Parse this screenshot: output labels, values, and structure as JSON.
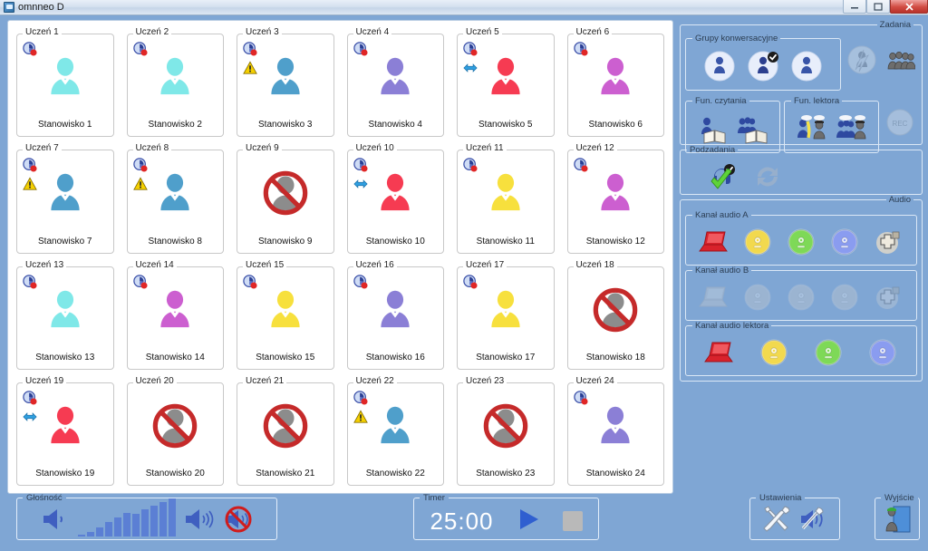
{
  "window": {
    "title": "omnneo D",
    "icon": "app-icon",
    "controls": [
      {
        "name": "minimize",
        "glyph": "—"
      },
      {
        "name": "maximize",
        "glyph": "❐"
      },
      {
        "name": "close",
        "glyph": "✕"
      }
    ]
  },
  "students": [
    {
      "student": "Uczeń 1",
      "station": "Stanowisko 1",
      "color": "#7fe8e8",
      "state": "online",
      "badges": [
        "clock-badge"
      ]
    },
    {
      "student": "Uczeń 2",
      "station": "Stanowisko 2",
      "color": "#7fe8e8",
      "state": "online",
      "badges": [
        "clock-badge"
      ]
    },
    {
      "student": "Uczeń 3",
      "station": "Stanowisko 3",
      "color": "#4f9fcb",
      "state": "online",
      "badges": [
        "clock-badge",
        "warning-badge"
      ]
    },
    {
      "student": "Uczeń 4",
      "station": "Stanowisko 4",
      "color": "#8b7fd6",
      "state": "online",
      "badges": [
        "clock-badge"
      ]
    },
    {
      "student": "Uczeń 5",
      "station": "Stanowisko 5",
      "color": "#f63b52",
      "state": "online",
      "badges": [
        "clock-badge",
        "arrows-badge"
      ]
    },
    {
      "student": "Uczeń 6",
      "station": "Stanowisko 6",
      "color": "#cc5fd0",
      "state": "online",
      "badges": [
        "clock-badge"
      ]
    },
    {
      "student": "Uczeń 7",
      "station": "Stanowisko 7",
      "color": "#4f9fcb",
      "state": "online",
      "badges": [
        "clock-badge",
        "warning-badge"
      ]
    },
    {
      "student": "Uczeń 8",
      "station": "Stanowisko 8",
      "color": "#4f9fcb",
      "state": "online",
      "badges": [
        "clock-badge",
        "warning-badge"
      ]
    },
    {
      "student": "Uczeń 9",
      "station": "Stanowisko 9",
      "color": "#8c8c8c",
      "state": "blocked",
      "badges": []
    },
    {
      "student": "Uczeń 10",
      "station": "Stanowisko 10",
      "color": "#f63b52",
      "state": "online",
      "badges": [
        "clock-badge",
        "arrows-badge"
      ]
    },
    {
      "student": "Uczeń 11",
      "station": "Stanowisko 11",
      "color": "#f7e03d",
      "state": "online",
      "badges": [
        "clock-badge"
      ]
    },
    {
      "student": "Uczeń 12",
      "station": "Stanowisko 12",
      "color": "#cc5fd0",
      "state": "online",
      "badges": [
        "clock-badge"
      ]
    },
    {
      "student": "Uczeń 13",
      "station": "Stanowisko 13",
      "color": "#7fe8e8",
      "state": "online",
      "badges": [
        "clock-badge"
      ]
    },
    {
      "student": "Uczeń 14",
      "station": "Stanowisko 14",
      "color": "#cc5fd0",
      "state": "online",
      "badges": [
        "clock-badge"
      ]
    },
    {
      "student": "Uczeń 15",
      "station": "Stanowisko 15",
      "color": "#f7e03d",
      "state": "online",
      "badges": [
        "clock-badge"
      ]
    },
    {
      "student": "Uczeń 16",
      "station": "Stanowisko 16",
      "color": "#8b7fd6",
      "state": "online",
      "badges": [
        "clock-badge"
      ]
    },
    {
      "student": "Uczeń 17",
      "station": "Stanowisko 17",
      "color": "#f7e03d",
      "state": "online",
      "badges": [
        "clock-badge"
      ]
    },
    {
      "student": "Uczeń 18",
      "station": "Stanowisko 18",
      "color": "#8c8c8c",
      "state": "blocked",
      "badges": []
    },
    {
      "student": "Uczeń 19",
      "station": "Stanowisko 19",
      "color": "#f63b52",
      "state": "online",
      "badges": [
        "clock-badge",
        "arrows-badge"
      ]
    },
    {
      "student": "Uczeń 20",
      "station": "Stanowisko 20",
      "color": "#8c8c8c",
      "state": "blocked",
      "badges": []
    },
    {
      "student": "Uczeń 21",
      "station": "Stanowisko 21",
      "color": "#8c8c8c",
      "state": "blocked",
      "badges": []
    },
    {
      "student": "Uczeń 22",
      "station": "Stanowisko 22",
      "color": "#4f9fcb",
      "state": "online",
      "badges": [
        "clock-badge",
        "warning-badge"
      ]
    },
    {
      "student": "Uczeń 23",
      "station": "Stanowisko 23",
      "color": "#8c8c8c",
      "state": "blocked",
      "badges": []
    },
    {
      "student": "Uczeń 24",
      "station": "Stanowisko 24",
      "color": "#8b7fd6",
      "state": "online",
      "badges": [
        "clock-badge"
      ]
    }
  ],
  "tasks": {
    "legend": "Zadania",
    "conversation_groups": {
      "legend": "Grupy konwersacyjne",
      "buttons": [
        {
          "name": "group-1-button",
          "icon": "person-circle-icon",
          "selected": false
        },
        {
          "name": "group-2-button",
          "icon": "person-circle-checked-icon",
          "selected": true
        },
        {
          "name": "group-3-button",
          "icon": "person-circle-icon",
          "selected": false
        }
      ]
    },
    "extra_buttons": [
      {
        "name": "break-conversation-button",
        "icon": "broken-link-icon",
        "disabled": true
      },
      {
        "name": "all-groups-button",
        "icon": "crowd-icon",
        "disabled": false
      }
    ],
    "reading": {
      "legend": "Fun. czytania",
      "buttons": [
        {
          "name": "reading-single-button",
          "icon": "person-book-icon"
        },
        {
          "name": "reading-group-button",
          "icon": "group-book-icon"
        }
      ]
    },
    "lecturer": {
      "legend": "Fun. lektora",
      "buttons": [
        {
          "name": "lecturer-single-button",
          "icon": "lecturer-person-icon"
        },
        {
          "name": "lecturer-group-button",
          "icon": "lecturer-group-icon"
        }
      ]
    },
    "record_button": {
      "name": "record-button",
      "icon": "rec-icon",
      "disabled": true
    }
  },
  "subtasks": {
    "legend": "Podzadania",
    "buttons": [
      {
        "name": "confirm-subtask-button",
        "icon": "headset-check-icon",
        "disabled": false
      },
      {
        "name": "refresh-subtask-button",
        "icon": "refresh-icon",
        "disabled": true
      }
    ]
  },
  "audio": {
    "legend": "Audio",
    "channels": [
      {
        "legend": "Kanał audio A",
        "disabled": false,
        "buttons": [
          {
            "name": "channel-a-laptop-button",
            "icon": "laptop-icon",
            "color": "#d8222c"
          },
          {
            "name": "channel-a-cd-yellow-button",
            "icon": "cd-icon",
            "color": "#f2d94e"
          },
          {
            "name": "channel-a-cd-green-button",
            "icon": "cd-icon",
            "color": "#7ed957"
          },
          {
            "name": "channel-a-cd-blue-button",
            "icon": "cd-icon",
            "color": "#8a9cf0"
          },
          {
            "name": "channel-a-add-button",
            "icon": "plus-icon",
            "color": "#cfc7b8"
          }
        ]
      },
      {
        "legend": "Kanał audio B",
        "disabled": true,
        "buttons": [
          {
            "name": "channel-b-laptop-button",
            "icon": "laptop-icon",
            "color": "#d8222c"
          },
          {
            "name": "channel-b-cd-yellow-button",
            "icon": "cd-icon",
            "color": "#f2d94e"
          },
          {
            "name": "channel-b-cd-green-button",
            "icon": "cd-icon",
            "color": "#7ed957"
          },
          {
            "name": "channel-b-cd-blue-button",
            "icon": "cd-icon",
            "color": "#8a9cf0"
          },
          {
            "name": "channel-b-add-button",
            "icon": "plus-icon",
            "color": "#cfc7b8"
          }
        ]
      },
      {
        "legend": "Kanał audio lektora",
        "disabled": false,
        "buttons": [
          {
            "name": "channel-lecturer-laptop-button",
            "icon": "laptop-icon",
            "color": "#d8222c"
          },
          {
            "name": "channel-lecturer-cd-yellow-button",
            "icon": "cd-icon",
            "color": "#f2d94e"
          },
          {
            "name": "channel-lecturer-cd-green-button",
            "icon": "cd-icon",
            "color": "#7ed957"
          },
          {
            "name": "channel-lecturer-cd-blue-button",
            "icon": "cd-icon",
            "color": "#8a9cf0"
          }
        ]
      }
    ]
  },
  "volume": {
    "legend": "Głośność",
    "down_button": {
      "name": "volume-down-button",
      "icon": "speaker-low-icon"
    },
    "up_button": {
      "name": "volume-up-button",
      "icon": "speaker-high-icon"
    },
    "mute_button": {
      "name": "mute-button",
      "icon": "speaker-mute-icon"
    },
    "levels": [
      2,
      5,
      10,
      16,
      21,
      26,
      25,
      30,
      34,
      38,
      42
    ]
  },
  "timer": {
    "legend": "Timer",
    "value": "25:00",
    "play_button": {
      "name": "timer-play-button",
      "icon": "play-icon"
    },
    "stop_button": {
      "name": "timer-stop-button",
      "icon": "stop-icon",
      "disabled": true
    }
  },
  "settings": {
    "legend": "Ustawienia",
    "buttons": [
      {
        "name": "settings-tools-button",
        "icon": "wrench-screwdriver-icon"
      },
      {
        "name": "audio-settings-button",
        "icon": "speaker-tools-icon"
      }
    ]
  },
  "exit": {
    "legend": "Wyjście",
    "button": {
      "name": "exit-button",
      "icon": "exit-door-icon"
    }
  }
}
